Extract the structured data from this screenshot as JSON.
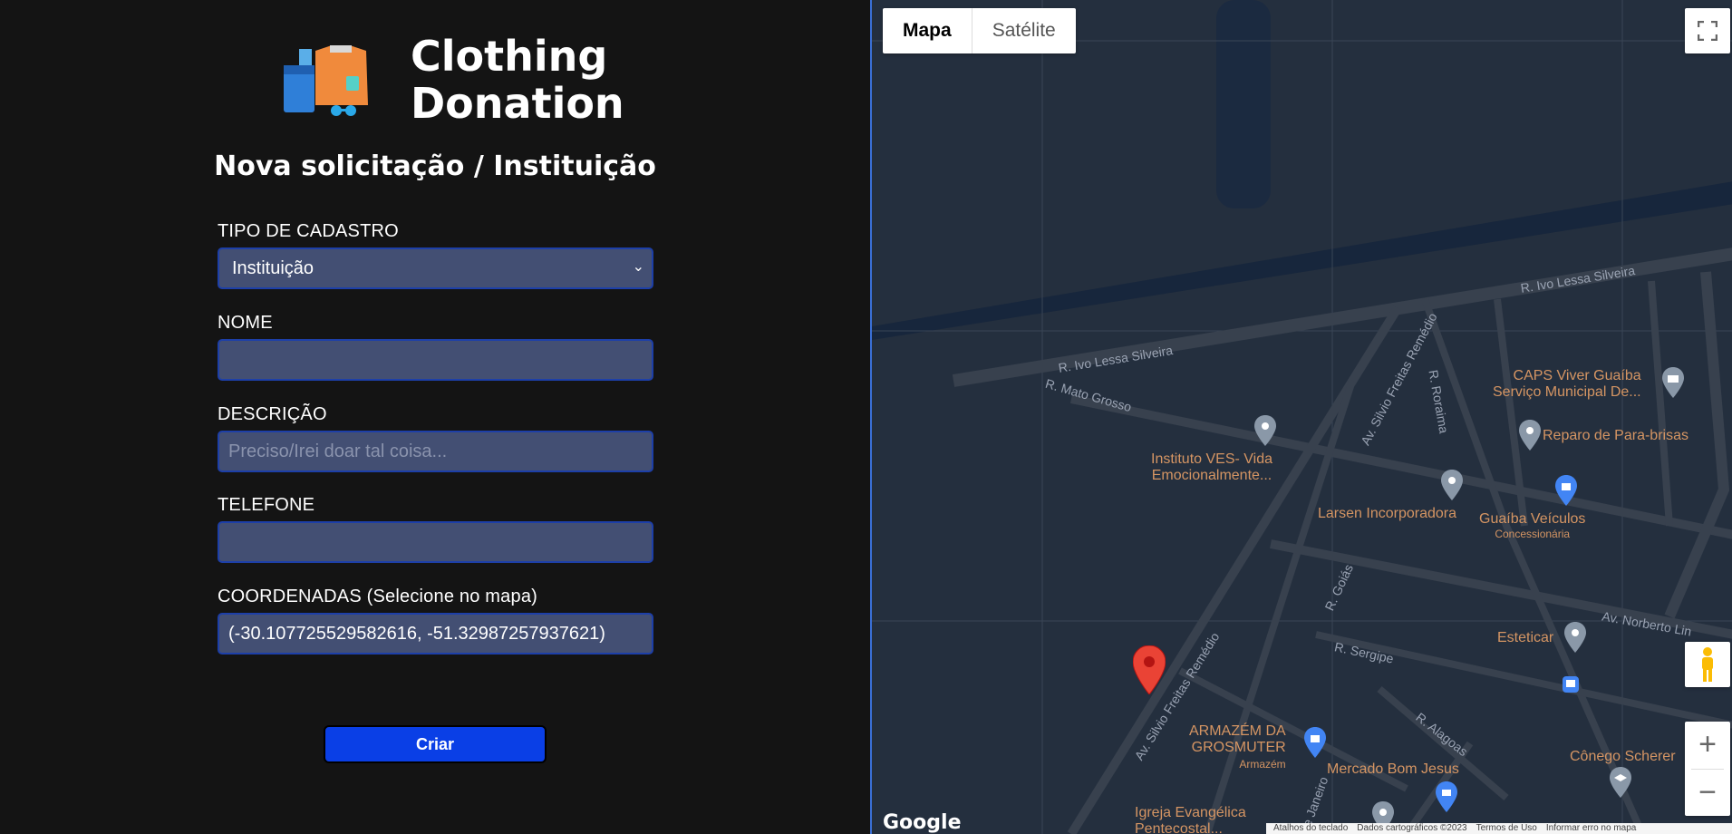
{
  "app": {
    "title_line1": "Clothing",
    "title_line2": "Donation"
  },
  "form": {
    "heading": "Nova solicitação / Instituição",
    "tipo_label": "TIPO DE CADASTRO",
    "tipo_value": "Instituição",
    "nome_label": "NOME",
    "nome_value": "",
    "descricao_label": "DESCRIÇÃO",
    "descricao_placeholder": "Preciso/Irei doar tal coisa...",
    "telefone_label": "TELEFONE",
    "telefone_value": "",
    "coordenadas_label": "COORDENADAS (Selecione no mapa)",
    "coordenadas_value": "(-30.107725529582616, -51.32987257937621)",
    "submit_label": "Criar"
  },
  "map": {
    "type_map": "Mapa",
    "type_satellite": "Satélite",
    "logo": "Google",
    "footer": [
      "Atalhos do teclado",
      "Dados cartográficos ©2023",
      "Termos de Uso",
      "Informar erro no mapa"
    ],
    "streets": {
      "ivo1": "R. Ivo Lessa Silveira",
      "ivo2": "R. Ivo Lessa Silveira",
      "mato": "R. Mato Grosso",
      "silvio1": "Av. Silvio Freitas Remédio",
      "silvio2": "Av. Silvio Freitas Remédio",
      "roraima": "R. Roraima",
      "goias": "R. Goiás",
      "sergipe": "R. Sergipe",
      "alagoas": "R. Alagoas",
      "norberto": "Av. Norberto Lin",
      "janeiro": "de Janeiro"
    },
    "places": {
      "caps1": "CAPS Viver Guaíba",
      "caps2": "Serviço Municipal De...",
      "reparo": "Reparo de Para-brisas",
      "ves1": "Instituto VES- Vida",
      "ves2": "Emocionalmente...",
      "larsen": "Larsen Incorporadora",
      "guaiba": "Guaíba Veículos",
      "guaiba_sub": "Concessionária",
      "esteticar": "Esteticar",
      "armazem1": "ARMAZÉM DA",
      "armazem2": "GROSMUTER",
      "armazem_sub": "Armazém",
      "mercado": "Mercado Bom Jesus",
      "conego": "Cônego Scherer",
      "igreja1": "Igreja Evangélica",
      "igreja2": "Pentecostal..."
    },
    "colors": {
      "background": "#242f3e",
      "road": "#38414e",
      "poi_text": "#d59563",
      "marker": "#ea4335"
    }
  }
}
